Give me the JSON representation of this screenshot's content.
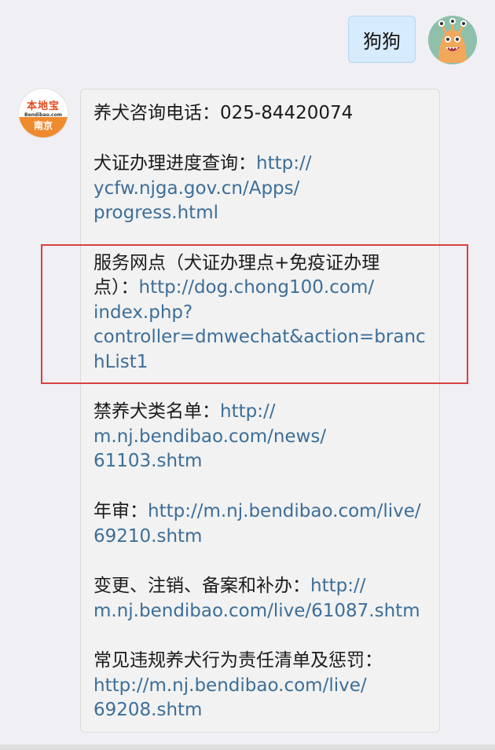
{
  "user_message": {
    "text": "狗狗"
  },
  "bot": {
    "avatar": {
      "logo": "本地宝",
      "site": "Bendibao.com",
      "city": "南京"
    }
  },
  "reply": {
    "hotline": {
      "label": "养犬咨询电话：025-84420074"
    },
    "progress": {
      "label": "犬证办理进度查询：",
      "url_lines": [
        "http://",
        "ycfw.njga.gov.cn/Apps/",
        "progress.html"
      ]
    },
    "service": {
      "label_lines": [
        "服务网点（犬证办理点+免疫证办理",
        "点）："
      ],
      "url_lines": [
        "http://dog.chong100.com/",
        "index.php?",
        "controller=dmwechat&action=branc",
        "hList1"
      ]
    },
    "banned": {
      "label": "禁养犬类名单：",
      "url_lines": [
        "http://",
        "m.nj.bendibao.com/news/",
        "61103.shtm"
      ]
    },
    "annual": {
      "label": "年审：",
      "url_lines": [
        "http://m.nj.bendibao.com/live/",
        "69210.shtm"
      ]
    },
    "change": {
      "label": "变更、注销、备案和补办：",
      "url_lines": [
        "http://",
        "m.nj.bendibao.com/live/61087.shtm"
      ]
    },
    "violation": {
      "label": "常见违规养犬行为责任清单及惩罚：",
      "url_lines": [
        "http://m.nj.bendibao.com/live/",
        "69208.shtm"
      ]
    }
  },
  "colors": {
    "link": "#3d6e98",
    "highlight": "#d8403e",
    "user_bubble": "#d6ebfb",
    "bot_bubble": "#f2f2f2"
  }
}
